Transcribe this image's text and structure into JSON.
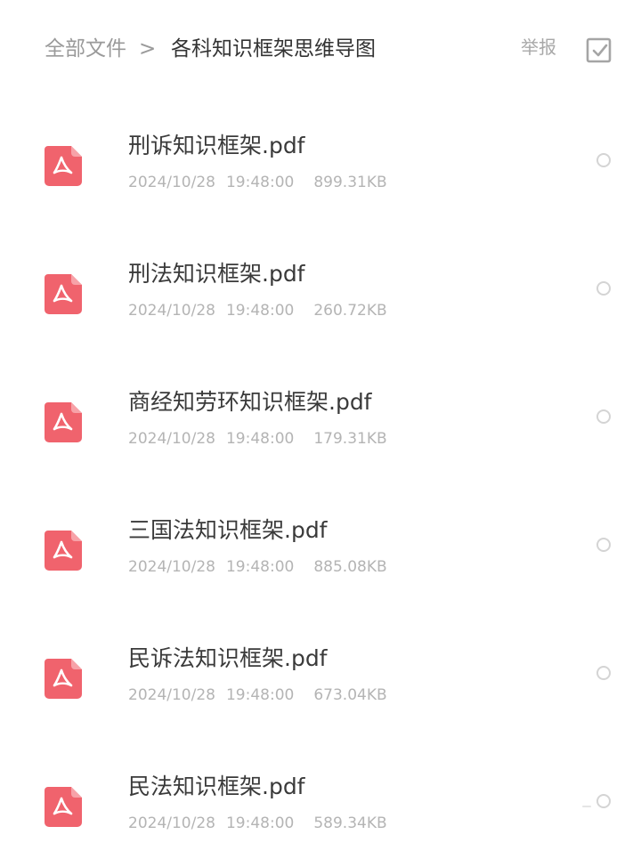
{
  "header": {
    "breadcrumb_root": "全部文件",
    "breadcrumb_separator": ">",
    "breadcrumb_current": "各科知识框架思维导图",
    "report_label": "举报"
  },
  "files": [
    {
      "name": "刑诉知识框架.pdf",
      "date": "2024/10/28",
      "time": "19:48:00",
      "size": "899.31KB"
    },
    {
      "name": "刑法知识框架.pdf",
      "date": "2024/10/28",
      "time": "19:48:00",
      "size": "260.72KB"
    },
    {
      "name": "商经知劳环知识框架.pdf",
      "date": "2024/10/28",
      "time": "19:48:00",
      "size": "179.31KB"
    },
    {
      "name": "三国法知识框架.pdf",
      "date": "2024/10/28",
      "time": "19:48:00",
      "size": "885.08KB"
    },
    {
      "name": "民诉法知识框架.pdf",
      "date": "2024/10/28",
      "time": "19:48:00",
      "size": "673.04KB"
    },
    {
      "name": "民法知识框架.pdf",
      "date": "2024/10/28",
      "time": "19:48:00",
      "size": "589.34KB"
    }
  ],
  "icons": {
    "file_icon": "pdf-file-icon",
    "select_all_icon": "checkbox-icon",
    "row_select_icon": "radio-circle-icon"
  },
  "colors": {
    "pdf_icon": "#f0636d",
    "text_primary": "#333333",
    "text_secondary": "#b4b4b4"
  }
}
